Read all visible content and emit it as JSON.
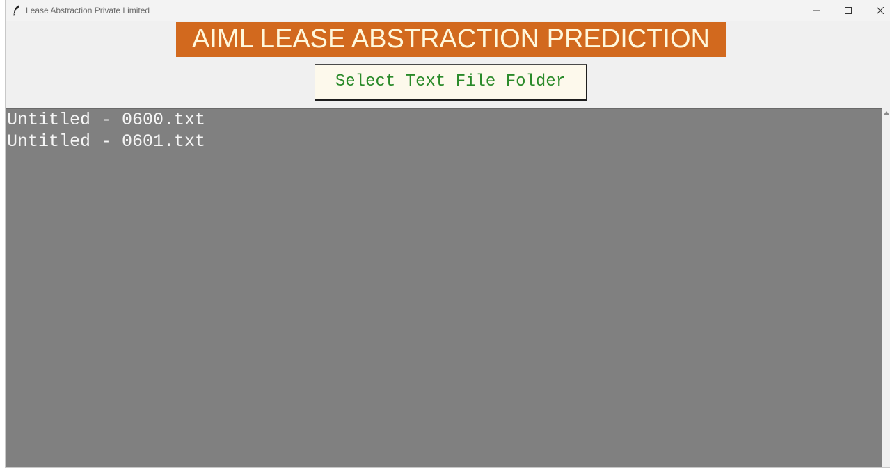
{
  "window": {
    "title": "Lease Abstraction Private Limited",
    "icon": "feather-icon",
    "controls": [
      "minimize-icon",
      "maximize-icon",
      "close-icon"
    ]
  },
  "header": {
    "banner_text": "AIML LEASE ABSTRACTION PREDICTION",
    "banner_bg": "#d2691e",
    "banner_fg": "#fff8dc"
  },
  "toolbar": {
    "select_folder_label": "Select Text File Folder",
    "button_fg": "#2a8a2a"
  },
  "output": {
    "background": "#808080",
    "files": [
      "Untitled - 0600.txt",
      "Untitled - 0601.txt"
    ]
  }
}
